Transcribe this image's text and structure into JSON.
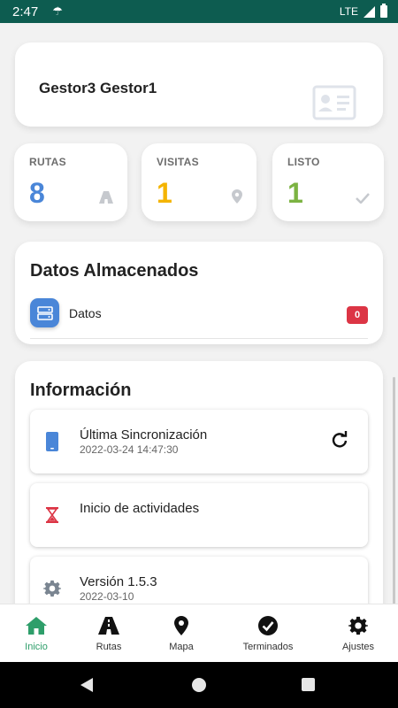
{
  "status_bar": {
    "time": "2:47",
    "network": "LTE"
  },
  "user": {
    "name": "Gestor3 Gestor1"
  },
  "stats": [
    {
      "label": "RUTAS",
      "value": "8",
      "color": "#4a86d8",
      "icon": "road-icon"
    },
    {
      "label": "VISITAS",
      "value": "1",
      "color": "#f4b400",
      "icon": "map-pin-icon"
    },
    {
      "label": "LISTO",
      "value": "1",
      "color": "#7cb342",
      "icon": "check-icon"
    }
  ],
  "stored": {
    "title": "Datos Almacenados",
    "items": [
      {
        "label": "Datos",
        "count": "0",
        "icon": "server-icon"
      }
    ]
  },
  "info": {
    "title": "Información",
    "items": [
      {
        "title": "Última Sincronización",
        "subtitle": "2022-03-24 14:47:30",
        "icon": "phone-icon",
        "action_icon": "refresh-icon"
      },
      {
        "title": "Inicio de actividades",
        "subtitle": "",
        "icon": "hourglass-icon"
      },
      {
        "title": "Versión 1.5.3",
        "subtitle": "2022-03-10",
        "icon": "gear-icon"
      }
    ]
  },
  "nav": [
    {
      "label": "Inicio",
      "icon": "home-icon",
      "active": true
    },
    {
      "label": "Rutas",
      "icon": "road-icon",
      "active": false
    },
    {
      "label": "Mapa",
      "icon": "map-marker-icon",
      "active": false
    },
    {
      "label": "Terminados",
      "icon": "check-circle-icon",
      "active": false
    },
    {
      "label": "Ajustes",
      "icon": "gear-icon",
      "active": false
    }
  ],
  "colors": {
    "status_bar": "#0d5c50",
    "accent": "#2e9e6a",
    "badge": "#dc3545",
    "primary": "#4a86d8"
  }
}
